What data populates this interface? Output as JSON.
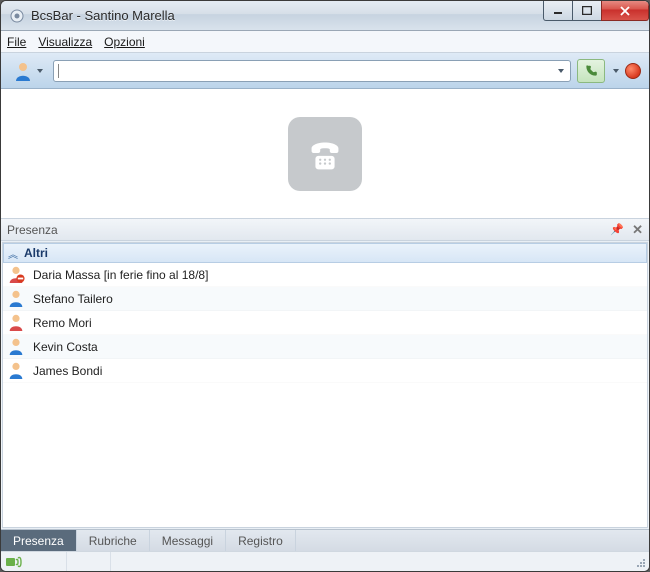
{
  "window": {
    "title": "BcsBar - Santino Marella"
  },
  "menu": {
    "file": "File",
    "view": "Visualizza",
    "options": "Opzioni"
  },
  "toolbar": {
    "search_value": "",
    "search_placeholder": ""
  },
  "presence_panel": {
    "title": "Presenza",
    "group": "Altri"
  },
  "contacts": [
    {
      "name": "Daria Massa [in ferie fino al 18/8]",
      "color": "red",
      "busy": true
    },
    {
      "name": "Stefano Tailero",
      "color": "blue",
      "busy": false
    },
    {
      "name": "Remo Mori",
      "color": "red",
      "busy": false
    },
    {
      "name": "Kevin Costa",
      "color": "blue",
      "busy": false
    },
    {
      "name": "James Bondi",
      "color": "blue",
      "busy": false
    }
  ],
  "tabs": {
    "presenza": "Presenza",
    "rubriche": "Rubriche",
    "messaggi": "Messaggi",
    "registro": "Registro"
  }
}
